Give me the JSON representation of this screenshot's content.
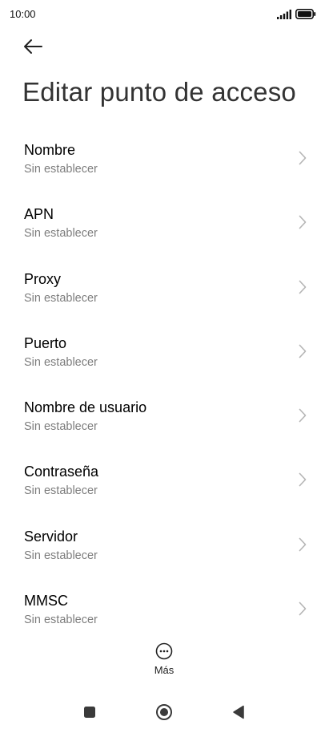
{
  "status_bar": {
    "time": "10:00"
  },
  "header": {
    "title": "Editar punto de acceso"
  },
  "items": [
    {
      "label": "Nombre",
      "value": "Sin establecer"
    },
    {
      "label": "APN",
      "value": "Sin establecer"
    },
    {
      "label": "Proxy",
      "value": "Sin establecer"
    },
    {
      "label": "Puerto",
      "value": "Sin establecer"
    },
    {
      "label": "Nombre de usuario",
      "value": "Sin establecer"
    },
    {
      "label": "Contraseña",
      "value": "Sin establecer"
    },
    {
      "label": "Servidor",
      "value": "Sin establecer"
    },
    {
      "label": "MMSC",
      "value": "Sin establecer"
    }
  ],
  "more": {
    "label": "Más"
  },
  "colors": {
    "background": "#ffffff",
    "title": "#333333",
    "label": "#000000",
    "secondary": "#7d7d7d",
    "chevron": "#b5b5b5"
  }
}
